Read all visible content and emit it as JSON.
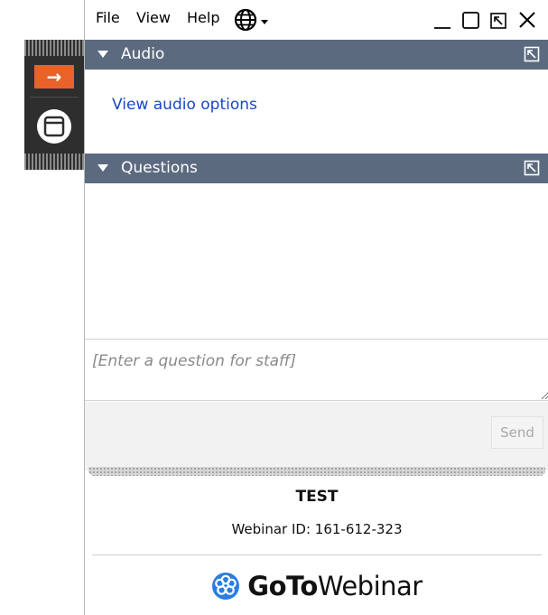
{
  "menu": {
    "file": "File",
    "view": "View",
    "help": "Help"
  },
  "icons": {
    "language": "globe-icon",
    "language_dropdown": "caret-down-icon",
    "minimize": "minimize-icon",
    "maximize": "maximize-icon",
    "restore": "restore-icon",
    "close": "close-icon",
    "show_panel": "arrow-right-icon",
    "panel_toggle": "window-panel-icon",
    "popout": "popout-icon",
    "brand_logo": "gotowebinar-logo-icon"
  },
  "colors": {
    "section_bar": "#5c6a80",
    "accent_orange": "#e8622a",
    "link_blue": "#1a47c8",
    "side_tab": "#2e2e2e"
  },
  "audio": {
    "title": "Audio",
    "link_label": "View audio options"
  },
  "questions": {
    "title": "Questions",
    "input_placeholder": "[Enter a question for staff]",
    "send_label": "Send"
  },
  "webinar": {
    "title": "TEST",
    "id_label": "Webinar ID: 161-612-323"
  },
  "brand": {
    "goto": "GoTo",
    "webinar": "Webinar"
  }
}
